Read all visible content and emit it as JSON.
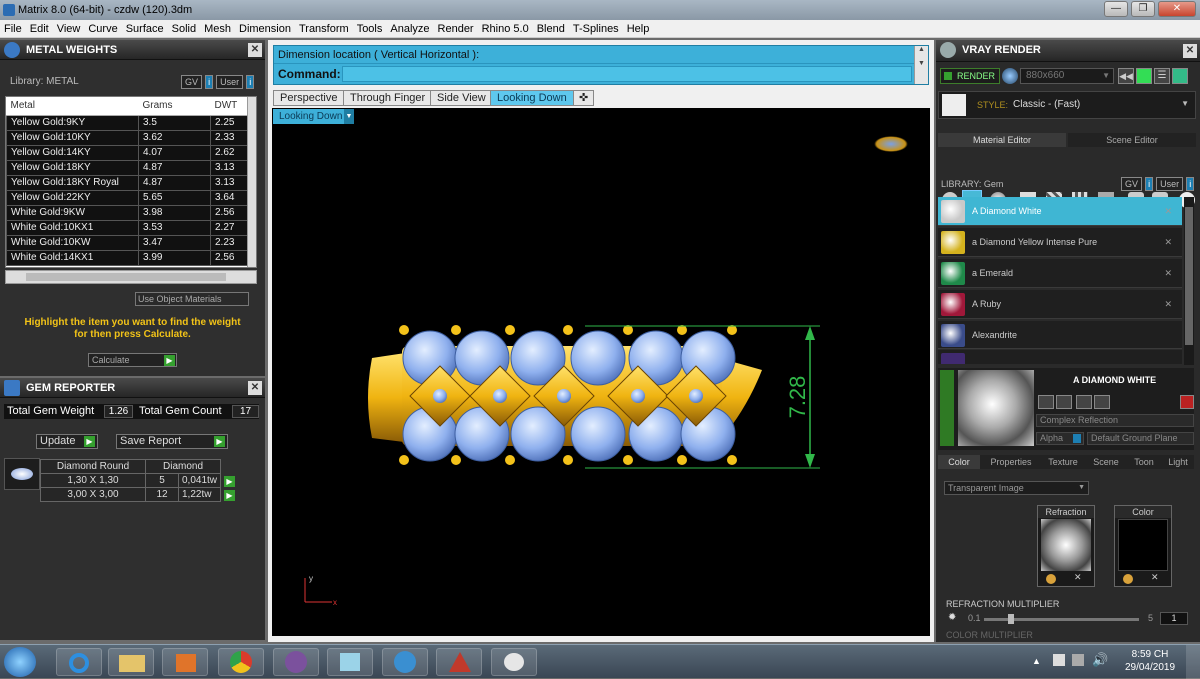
{
  "window": {
    "title": "Matrix 8.0 (64-bit) - czdw (120).3dm",
    "min": "—",
    "max": "❐",
    "close": "✕"
  },
  "menu": [
    "File",
    "Edit",
    "View",
    "Curve",
    "Surface",
    "Solid",
    "Mesh",
    "Dimension",
    "Transform",
    "Tools",
    "Analyze",
    "Render",
    "Rhino 5.0",
    "Blend",
    "T-Splines",
    "Help"
  ],
  "metal": {
    "title": "METAL WEIGHTS",
    "close": "✕",
    "library": "Library: METAL",
    "gv": "GV",
    "user": "User",
    "info": "i",
    "headers": [
      "Metal",
      "Grams",
      "DWT"
    ],
    "rows": [
      [
        "Yellow Gold:9KY",
        "3.5",
        "2.25"
      ],
      [
        "Yellow Gold:10KY",
        "3.62",
        "2.33"
      ],
      [
        "Yellow Gold:14KY",
        "4.07",
        "2.62"
      ],
      [
        "Yellow Gold:18KY",
        "4.87",
        "3.13"
      ],
      [
        "Yellow Gold:18KY Royal",
        "4.87",
        "3.13"
      ],
      [
        "Yellow Gold:22KY",
        "5.65",
        "3.64"
      ],
      [
        "White Gold:9KW",
        "3.98",
        "2.56"
      ],
      [
        "White Gold:10KX1",
        "3.53",
        "2.27"
      ],
      [
        "White Gold:10KW",
        "3.47",
        "2.23"
      ],
      [
        "White Gold:14KX1",
        "3.99",
        "2.56"
      ]
    ],
    "use_object": "Use Object Materials",
    "hint1": "Highlight the item you want to find the weight",
    "hint2": "for then press Calculate.",
    "calculate": "Calculate"
  },
  "gem": {
    "title": "GEM REPORTER",
    "close": "✕",
    "total_weight_label": "Total Gem Weight",
    "total_weight": "1.26",
    "total_count_label": "Total Gem Count",
    "total_count": "17",
    "update": "Update",
    "save": "Save Report",
    "shape": "Diamond Round",
    "material": "Diamond",
    "rows": [
      [
        "1,30 X 1,30",
        "5",
        "0,041tw"
      ],
      [
        "3,00 X 3,00",
        "12",
        "1,22tw"
      ]
    ]
  },
  "command": {
    "prompt_line": "Dimension location ( Vertical  Horizontal ):",
    "label": "Command:"
  },
  "viewtabs": [
    "Perspective",
    "Through Finger",
    "Side View",
    "Looking Down"
  ],
  "active_view": "Looking Down",
  "dimension": "7.28",
  "axis": {
    "x": "x",
    "y": "y"
  },
  "vray": {
    "title": "VRAY RENDER",
    "render": "RENDER",
    "resolution": "880x660",
    "style_label": "STYLE:",
    "style_value": "Classic - (Fast)",
    "tabs": [
      "Material Editor",
      "Scene Editor"
    ],
    "library": "LIBRARY: Gem",
    "gv": "GV",
    "user": "User",
    "materials": [
      {
        "name": "A Diamond White",
        "color": "#c9c9c9"
      },
      {
        "name": "a Diamond Yellow Intense Pure",
        "color": "#d4b21e"
      },
      {
        "name": "a Emerald",
        "color": "#1f8a4a"
      },
      {
        "name": "A Ruby",
        "color": "#a0183a"
      },
      {
        "name": "Alexandrite",
        "color": "#3a4c8a"
      }
    ],
    "selected_name": "A DIAMOND WHITE",
    "reflection": "Complex Reflection",
    "alpha": "Alpha",
    "ground": "Default Ground Plane",
    "subtabs": [
      "Color",
      "Properties",
      "Texture",
      "Scene",
      "Toon",
      "Light"
    ],
    "color_mode": "Transparent Image",
    "refraction": "Refraction",
    "color_label": "Color",
    "refr_mult_label": "REFRACTION MULTIPLIER",
    "refr_min": "0.1",
    "refr_max": "5",
    "refr_val": "1",
    "color_mult_label": "COLOR MULTIPLIER"
  },
  "taskbar": {
    "time": "8:59 CH",
    "date": "29/04/2019"
  }
}
